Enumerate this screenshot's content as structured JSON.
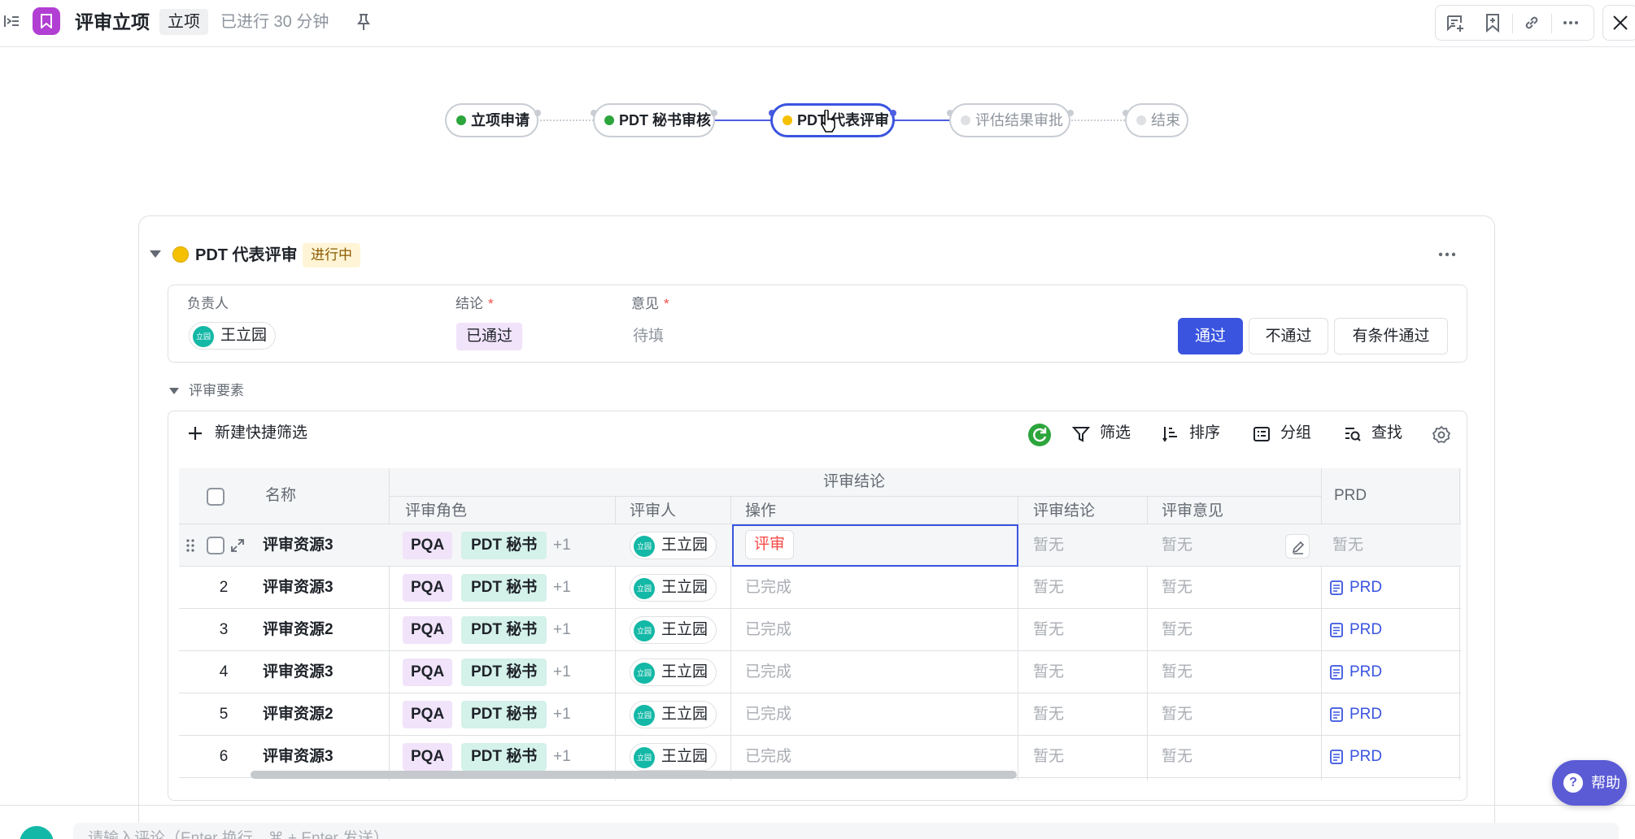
{
  "header": {
    "title": "评审立项",
    "tag": "立项",
    "elapsed": "已进行 30 分钟"
  },
  "stepper": {
    "steps": [
      {
        "label": "立项申请",
        "state": "done"
      },
      {
        "label": "PDT 秘书审核",
        "state": "done"
      },
      {
        "label": "PDT 代表评审",
        "state": "active"
      },
      {
        "label": "评估结果审批",
        "state": "pending"
      },
      {
        "label": "结束",
        "state": "pending"
      }
    ]
  },
  "section": {
    "title": "PDT 代表评审",
    "status": "进行中",
    "fields": {
      "owner_label": "负责人",
      "owner": "王立园",
      "conclusion_label": "结论",
      "conclusion": "已通过",
      "opinion_label": "意见",
      "opinion_placeholder": "待填",
      "required_mark": "*"
    },
    "buttons": {
      "pass": "通过",
      "reject": "不通过",
      "conditional": "有条件通过"
    }
  },
  "elements": {
    "title": "评审要素",
    "toolbar": {
      "new_filter": "新建快捷筛选",
      "filter": "筛选",
      "sort": "排序",
      "group": "分组",
      "find": "查找"
    },
    "table": {
      "headers": {
        "name": "名称",
        "group": "评审结论",
        "role": "评审角色",
        "reviewer": "评审人",
        "action": "操作",
        "conclusion": "评审结论",
        "opinion": "评审意见",
        "prd": "PRD"
      },
      "review_btn": "评审",
      "rows": [
        {
          "num": "",
          "name": "评审资源3",
          "role1": "PQA",
          "role2": "PDT 秘书",
          "more": "+1",
          "reviewer": "王立园",
          "action": "评审",
          "conclusion": "暂无",
          "opinion": "暂无",
          "prd": "暂无"
        },
        {
          "num": "2",
          "name": "评审资源3",
          "role1": "PQA",
          "role2": "PDT 秘书",
          "more": "+1",
          "reviewer": "王立园",
          "action": "已完成",
          "conclusion": "暂无",
          "opinion": "暂无",
          "prd": "PRD"
        },
        {
          "num": "3",
          "name": "评审资源2",
          "role1": "PQA",
          "role2": "PDT 秘书",
          "more": "+1",
          "reviewer": "王立园",
          "action": "已完成",
          "conclusion": "暂无",
          "opinion": "暂无",
          "prd": "PRD"
        },
        {
          "num": "4",
          "name": "评审资源3",
          "role1": "PQA",
          "role2": "PDT 秘书",
          "more": "+1",
          "reviewer": "王立园",
          "action": "已完成",
          "conclusion": "暂无",
          "opinion": "暂无",
          "prd": "PRD"
        },
        {
          "num": "5",
          "name": "评审资源2",
          "role1": "PQA",
          "role2": "PDT 秘书",
          "more": "+1",
          "reviewer": "王立园",
          "action": "已完成",
          "conclusion": "暂无",
          "opinion": "暂无",
          "prd": "PRD"
        },
        {
          "num": "6",
          "name": "评审资源3",
          "role1": "PQA",
          "role2": "PDT 秘书",
          "more": "+1",
          "reviewer": "王立园",
          "action": "已完成",
          "conclusion": "暂无",
          "opinion": "暂无",
          "prd": "PRD"
        }
      ]
    }
  },
  "comment": {
    "placeholder": "请输入评论（Enter 换行，⌘ + Enter 发送）"
  },
  "help": {
    "label": "帮助",
    "icon_glyph": "?"
  },
  "colors": {
    "accent": "#3a54e0",
    "app_icon": "#b13fd3",
    "done": "#2ca53c",
    "active": "#f5c000"
  },
  "icons": [
    "sidebar-toggle-icon",
    "bookmark-icon",
    "pin-icon",
    "comment-add-icon",
    "bookmark-add-icon",
    "link-icon",
    "more-icon",
    "close-icon",
    "caret-down-icon",
    "plus-icon",
    "refresh-icon",
    "filter-icon",
    "sort-icon",
    "group-icon",
    "find-icon",
    "settings-icon",
    "drag-handle-icon",
    "expand-icon",
    "edit-icon",
    "doc-icon",
    "help-icon"
  ]
}
